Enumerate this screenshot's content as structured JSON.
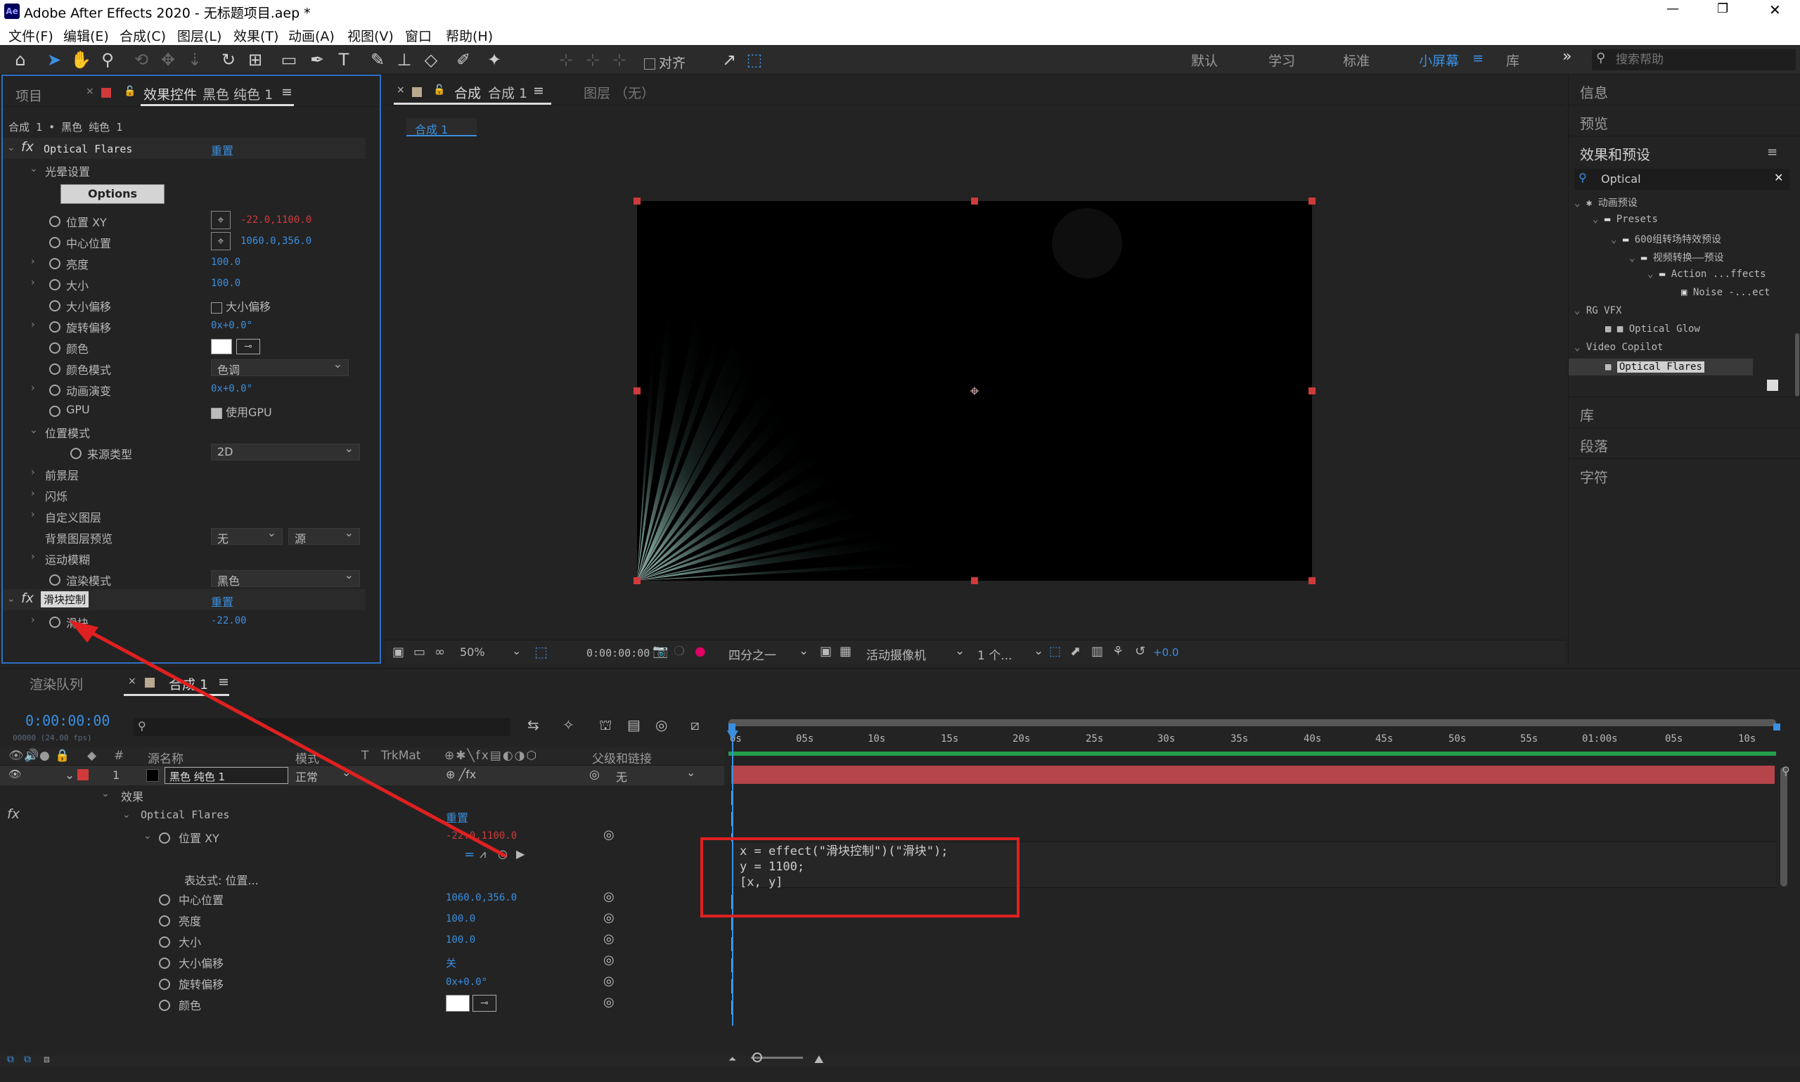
{
  "app": {
    "title": "Adobe After Effects 2020 - 无标题项目.aep *",
    "logo": "Ae"
  },
  "window_controls": {
    "minimize": "—",
    "restore": "❐",
    "close": "✕"
  },
  "menu": [
    "文件(F)",
    "编辑(E)",
    "合成(C)",
    "图层(L)",
    "效果(T)",
    "动画(A)",
    "视图(V)",
    "窗口",
    "帮助(H)"
  ],
  "toolbar": {
    "snap_label": "对齐",
    "workspaces": [
      "默认",
      "学习",
      "标准",
      "小屏幕",
      "库"
    ],
    "active_workspace": "小屏幕",
    "more": "»",
    "search_placeholder": "搜索帮助"
  },
  "effect_controls": {
    "tab_project": "项目",
    "tab_label": "效果控件",
    "tab_layer": "黑色 纯色 1",
    "breadcrumb": "合成 1 • 黑色 纯色 1",
    "fx1_name": "Optical Flares",
    "reset": "重置",
    "group_lens": "光晕设置",
    "options_btn": "Options",
    "props": [
      {
        "label": "位置 XY",
        "value": "-22.0,1100.0"
      },
      {
        "label": "中心位置",
        "value": "1060.0,356.0"
      },
      {
        "label": "亮度",
        "value": "100.0"
      },
      {
        "label": "大小",
        "value": "100.0"
      },
      {
        "label": "大小偏移",
        "value": "大小偏移"
      },
      {
        "label": "旋转偏移",
        "value": "0x+0.0°"
      },
      {
        "label": "颜色",
        "value": ""
      },
      {
        "label": "颜色模式",
        "value": "色调"
      },
      {
        "label": "动画演变",
        "value": "0x+0.0°"
      },
      {
        "label": "GPU",
        "value": "使用GPU"
      }
    ],
    "group_position_mode": "位置模式",
    "source_type_label": "来源类型",
    "source_type_value": "2D",
    "foreground": "前景层",
    "flicker": "闪烁",
    "custom_layer": "自定义图层",
    "bg_preview_label": "背景图层预览",
    "bg_preview_value1": "无",
    "bg_preview_value2": "源",
    "motion_blur": "运动模糊",
    "render_mode_label": "渲染模式",
    "render_mode_value": "黑色",
    "fx2_name": "滑块控制",
    "slider_label": "滑块",
    "slider_value": "-22.00"
  },
  "composition": {
    "tab_label": "合成",
    "tab_name": "合成 1",
    "layer_tab": "图层 （无）",
    "sub_tab": "合成 1",
    "zoom": "50%",
    "timecode": "0:00:00:00",
    "resolution": "四分之一",
    "camera": "活动摄像机",
    "views": "1 个...",
    "exposure": "+0.0"
  },
  "right_panel": {
    "info": "信息",
    "preview": "预览",
    "effects_presets": "效果和预设",
    "search_value": "Optical",
    "tree": [
      "动画预设",
      "Presets",
      "600组转场特效预设",
      "视频转换——预设",
      "Action ...ffects",
      "Noise -...ect",
      "RG VFX",
      "Optical Glow",
      "Video Copilot",
      "Optical Flares"
    ],
    "library": "库",
    "paragraph": "段落",
    "character": "字符"
  },
  "timeline": {
    "render_queue_tab": "渲染队列",
    "comp_tab": "合成 1",
    "timecode": "0:00:00:00",
    "fps": "00000 (24.00 fps)",
    "col_num": "#",
    "col_source": "源名称",
    "col_mode": "模式",
    "col_t": "T",
    "col_trkmat": "TrkMat",
    "col_parent": "父级和链接",
    "ruler": [
      "0s",
      "05s",
      "10s",
      "15s",
      "20s",
      "25s",
      "30s",
      "35s",
      "40s",
      "45s",
      "50s",
      "55s",
      "01:00s",
      "05s",
      "10s"
    ],
    "layer_num": "1",
    "layer_name": "黑色 纯色 1",
    "layer_mode": "正常",
    "layer_parent": "无",
    "effects_label": "效果",
    "fx_name": "Optical Flares",
    "reset": "重置",
    "pos_label": "位置 XY",
    "pos_value": "-22.0,1100.0",
    "expr_label": "表达式: 位置...",
    "expression": [
      "x = effect(\"滑块控制\")(\"滑块\");",
      "y = 1100;",
      "[x, y]"
    ],
    "props": [
      {
        "label": "中心位置",
        "value": "1060.0,356.0"
      },
      {
        "label": "亮度",
        "value": "100.0"
      },
      {
        "label": "大小",
        "value": "100.0"
      },
      {
        "label": "大小偏移",
        "value": "关"
      },
      {
        "label": "旋转偏移",
        "value": "0x+0.0°"
      },
      {
        "label": "颜色",
        "value": ""
      }
    ]
  },
  "colors": {
    "accent": "#3b8fe0",
    "handle": "#d03a3a",
    "annotation": "#e02020",
    "layer_bar": "#b5444b"
  }
}
